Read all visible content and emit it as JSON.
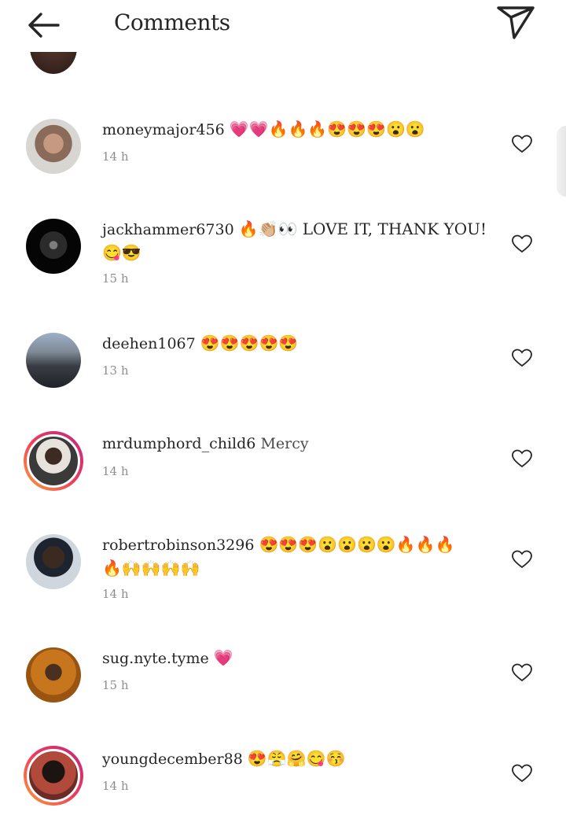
{
  "header": {
    "title": "Comments"
  },
  "colors": {
    "heart_emoji": "#e0457b",
    "story_ring": "#ee3b5d",
    "time_text": "#8e8e8e"
  },
  "comments": [
    {
      "username": "moneymajor456",
      "text": "💗💗🔥🔥🔥😍😍😍😮😮",
      "time": "14 h"
    },
    {
      "username": "jackhammer6730",
      "text": "🔥👏🏼👀 LOVE IT, THANK YOU!",
      "text2": "😋😎",
      "time": "15 h"
    },
    {
      "username": "deehen1067",
      "text": "😍😍😍😍😍",
      "time": "13 h"
    },
    {
      "username": "mrdumphord_child6",
      "text": "Mercy",
      "time": "14 h"
    },
    {
      "username": "robertrobinson3296",
      "text": "😍😍😍😮😮😮😮🔥🔥🔥",
      "text2": "🔥🙌🙌🙌🙌",
      "time": "14 h"
    },
    {
      "username": "sug.nyte.tyme",
      "text": "💗",
      "time": "15 h"
    },
    {
      "username": "youngdecember88",
      "text": "😍😤🤗😋😚",
      "time": "14 h"
    }
  ]
}
